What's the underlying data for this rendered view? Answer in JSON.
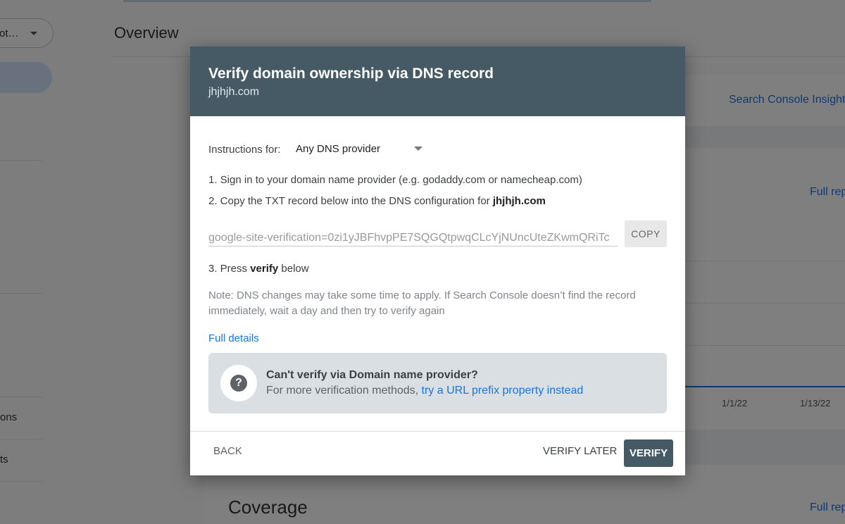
{
  "background": {
    "property_selector": "ot…",
    "page_title": "Overview",
    "nav_fragments": [
      "ons",
      "ts"
    ],
    "insights_link": "Search Console Insights",
    "full_report_link": "Full rep",
    "chart_x_ticks": [
      "1/1/22",
      "1/13/22"
    ],
    "section_title": "Coverage"
  },
  "dialog": {
    "title": "Verify domain ownership via DNS record",
    "domain": "jhjhjh.com",
    "instructions_label": "Instructions for:",
    "instructions_value": "Any DNS provider",
    "step1": "1. Sign in to your domain name provider (e.g. godaddy.com or namecheap.com)",
    "step2_prefix": "2. Copy the TXT record below into the DNS configuration for ",
    "step2_domain": "jhjhjh.com",
    "txt_record": "google-site-verification=0zi1yJBFhvpPE7SQGQtpwqCLcYjNUncUteZKwmQRiTc",
    "copy_label": "COPY",
    "step3_prefix": "3. Press ",
    "step3_bold": "verify",
    "step3_suffix": " below",
    "note": "Note: DNS changes may take some time to apply. If Search Console doesn’t find the record immediately, wait a day and then try to verify again",
    "full_details": "Full details",
    "help": {
      "icon": "?",
      "title": "Can't verify via Domain name provider?",
      "text_prefix": "For more verification methods, ",
      "link": "try a URL prefix property instead"
    },
    "buttons": {
      "back": "BACK",
      "verify_later": "VERIFY LATER",
      "verify": "VERIFY"
    }
  }
}
